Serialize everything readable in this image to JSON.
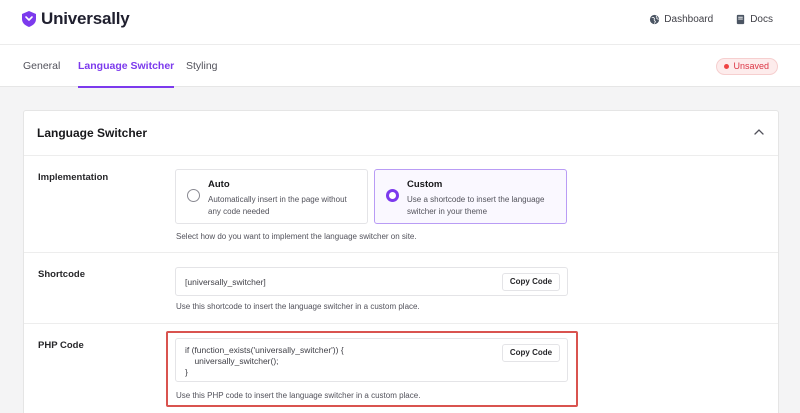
{
  "brand": {
    "name": "Universally",
    "accent": "#7c3aed"
  },
  "top_links": [
    {
      "label": "Dashboard",
      "icon": "globe-icon"
    },
    {
      "label": "Docs",
      "icon": "book-icon"
    }
  ],
  "tabs": [
    {
      "label": "General",
      "active": false
    },
    {
      "label": "Language Switcher",
      "active": true
    },
    {
      "label": "Styling",
      "active": false
    }
  ],
  "status_badge": "Unsaved",
  "section": {
    "title": "Language Switcher",
    "implementation": {
      "label": "Implementation",
      "options": [
        {
          "title": "Auto",
          "description": "Automatically insert in the page without any code needed",
          "selected": false
        },
        {
          "title": "Custom",
          "description": "Use a shortcode to insert the language switcher in your theme",
          "selected": true
        }
      ],
      "help": "Select how do you want to implement the language switcher on site."
    },
    "shortcode": {
      "label": "Shortcode",
      "value": "[universally_switcher]",
      "copy_label": "Copy Code",
      "help": "Use this shortcode to insert the language switcher in a custom place."
    },
    "php_code": {
      "label": "PHP Code",
      "lines": [
        "if (function_exists('universally_switcher')) {",
        "    universally_switcher();",
        "}"
      ],
      "copy_label": "Copy Code",
      "help": "Use this PHP code to insert the language switcher in a custom place."
    }
  }
}
